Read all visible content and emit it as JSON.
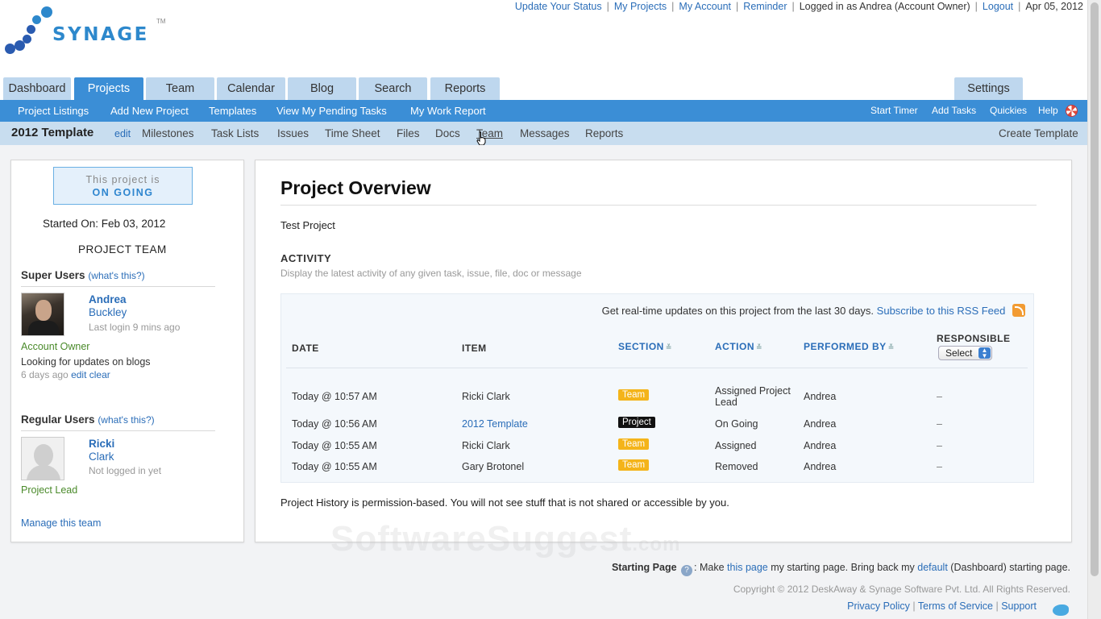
{
  "toplinks": {
    "update_status": "Update Your Status",
    "my_projects": "My Projects",
    "my_account": "My Account",
    "reminder": "Reminder",
    "logged_in": "Logged in as Andrea (Account Owner)",
    "logout": "Logout",
    "date": "Apr 05, 2012",
    "separator": "|"
  },
  "logo": {
    "text": "SYNAGE",
    "tm": "TM",
    "color": "#2d88cc"
  },
  "tabs": [
    "Dashboard",
    "Projects",
    "Team",
    "Calendar",
    "Blog",
    "Search",
    "Reports"
  ],
  "settings_tab": "Settings",
  "active_tab": "Projects",
  "bluebar": {
    "left": [
      "Project Listings",
      "Add New Project",
      "Templates",
      "View My Pending Tasks",
      "My Work Report"
    ],
    "right": [
      "Start Timer",
      "Add Tasks",
      "Quickies",
      "Help"
    ]
  },
  "subbar": {
    "project_title": "2012 Template",
    "edit": "edit",
    "items": [
      "Milestones",
      "Task Lists",
      "Issues",
      "Time Sheet",
      "Files",
      "Docs",
      "Team",
      "Messages",
      "Reports"
    ],
    "create_template": "Create Template"
  },
  "left": {
    "status_line1": "This project is",
    "status_line2": "ON GOING",
    "started_on": "Started On: Feb 03, 2012",
    "team_heading": "PROJECT TEAM",
    "super_users": "Super Users",
    "whats_this": "(what's this?)",
    "super_user": {
      "first": "Andrea",
      "last": "Buckley",
      "login": "Last login 9 mins ago",
      "role": "Account Owner",
      "status": "Looking for updates on blogs",
      "status_time": "6 days ago",
      "edit": "edit",
      "clear": "clear"
    },
    "regular_users": "Regular Users",
    "regular_user": {
      "first": "Ricki",
      "last": "Clark",
      "login": "Not logged in yet",
      "role": "Project Lead"
    },
    "manage": "Manage this team"
  },
  "main": {
    "title": "Project Overview",
    "description": "Test Project",
    "activity_heading": "ACTIVITY",
    "activity_sub": "Display the latest activity of any given task, issue, file, doc or message",
    "rss_text": "Get real-time updates on this project from the last 30 days.",
    "rss_link": "Subscribe to this RSS Feed",
    "columns": {
      "date": "DATE",
      "item": "ITEM",
      "section": "SECTION",
      "action": "ACTION",
      "performed_by": "PERFORMED BY",
      "responsible": "RESPONSIBLE"
    },
    "select_label": "Select",
    "rows": [
      {
        "date": "Today @ 10:57 AM",
        "item": "Ricki Clark",
        "section": "Team",
        "action": "Assigned Project Lead",
        "performed_by": "Andrea",
        "responsible": "–"
      },
      {
        "date": "Today @ 10:56 AM",
        "item": "2012 Template",
        "section": "Project",
        "action": "On Going",
        "performed_by": "Andrea",
        "responsible": "–"
      },
      {
        "date": "Today @ 10:55 AM",
        "item": "Ricki Clark",
        "section": "Team",
        "action": "Assigned",
        "performed_by": "Andrea",
        "responsible": "–"
      },
      {
        "date": "Today @ 10:55 AM",
        "item": "Gary Brotonel",
        "section": "Team",
        "action": "Removed",
        "performed_by": "Andrea",
        "responsible": "–"
      }
    ],
    "history_note": "Project History is permission-based. You will not see stuff that is not shared or accessible by you."
  },
  "footer": {
    "starting_page": "Starting Page",
    "make": ": Make",
    "this_page": "this page",
    "mid": "my starting page. Bring back my",
    "default": "default",
    "end": "(Dashboard) starting page.",
    "copyright": "Copyright © 2012 DeskAway & Synage Software Pvt. Ltd. All Rights Reserved.",
    "privacy": "Privacy Policy",
    "terms": "Terms of Service",
    "support": "Support"
  },
  "watermark": {
    "main": "SoftwareSuggest",
    "suffix": ".com"
  },
  "colors": {
    "primary": "#3b8ed6",
    "light": "#c8ddef",
    "tab": "#bed7ee",
    "team_badge": "#f4b41a",
    "project_badge": "#111111"
  }
}
